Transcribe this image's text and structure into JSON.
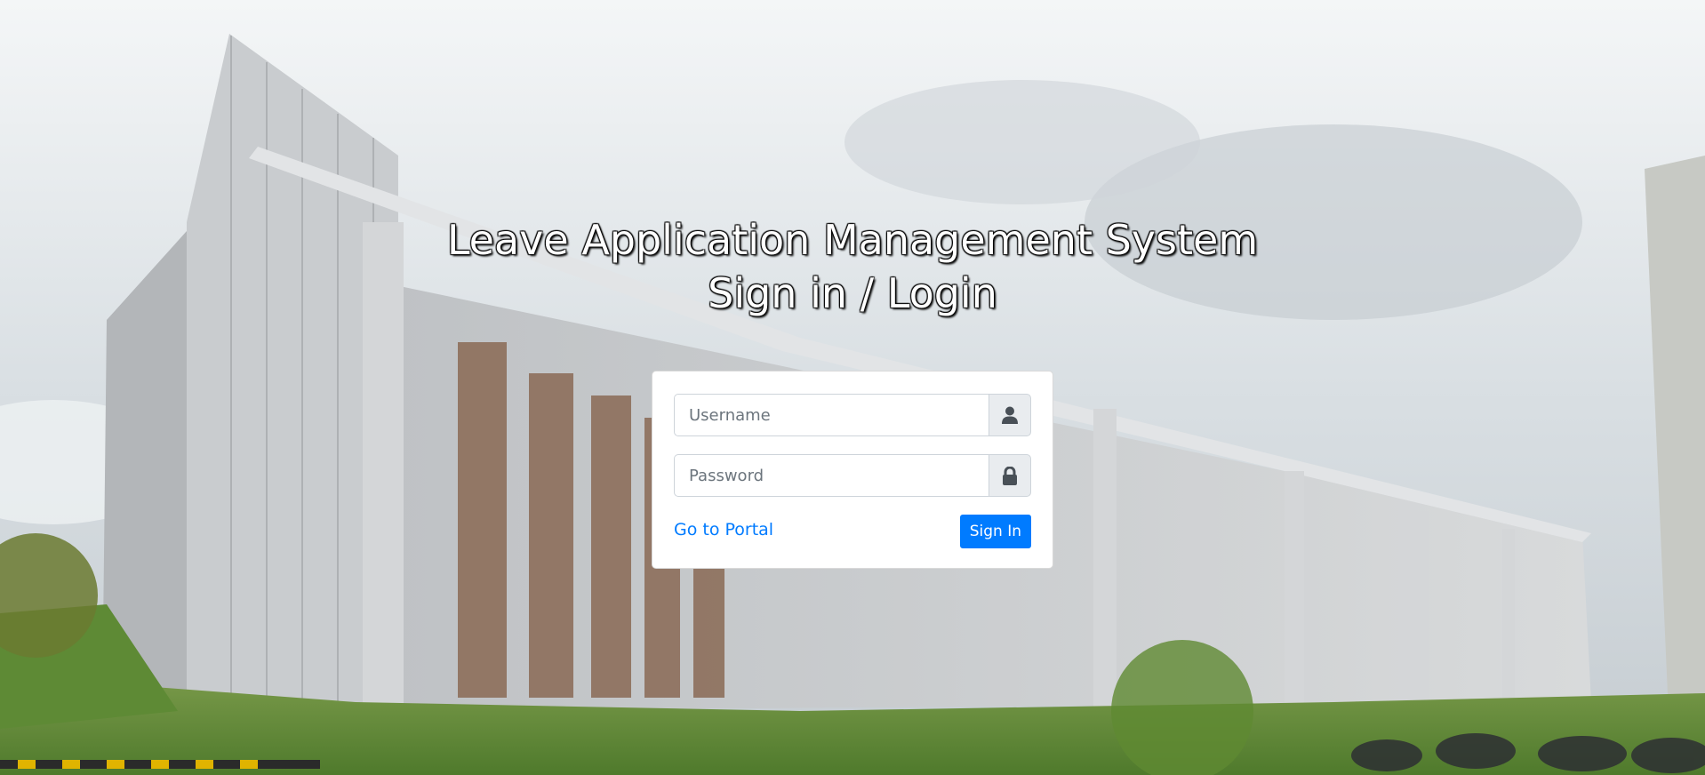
{
  "header": {
    "title_line1": "Leave Application Management System",
    "title_line2": "Sign in / Login"
  },
  "login_form": {
    "username": {
      "value": "",
      "placeholder": "Username",
      "icon": "user-icon"
    },
    "password": {
      "value": "",
      "placeholder": "Password",
      "icon": "lock-icon"
    },
    "portal_link_label": "Go to Portal",
    "signin_label": "Sign In"
  },
  "colors": {
    "primary": "#007bff",
    "addon_bg": "#e9ecef",
    "icon": "#495057"
  }
}
